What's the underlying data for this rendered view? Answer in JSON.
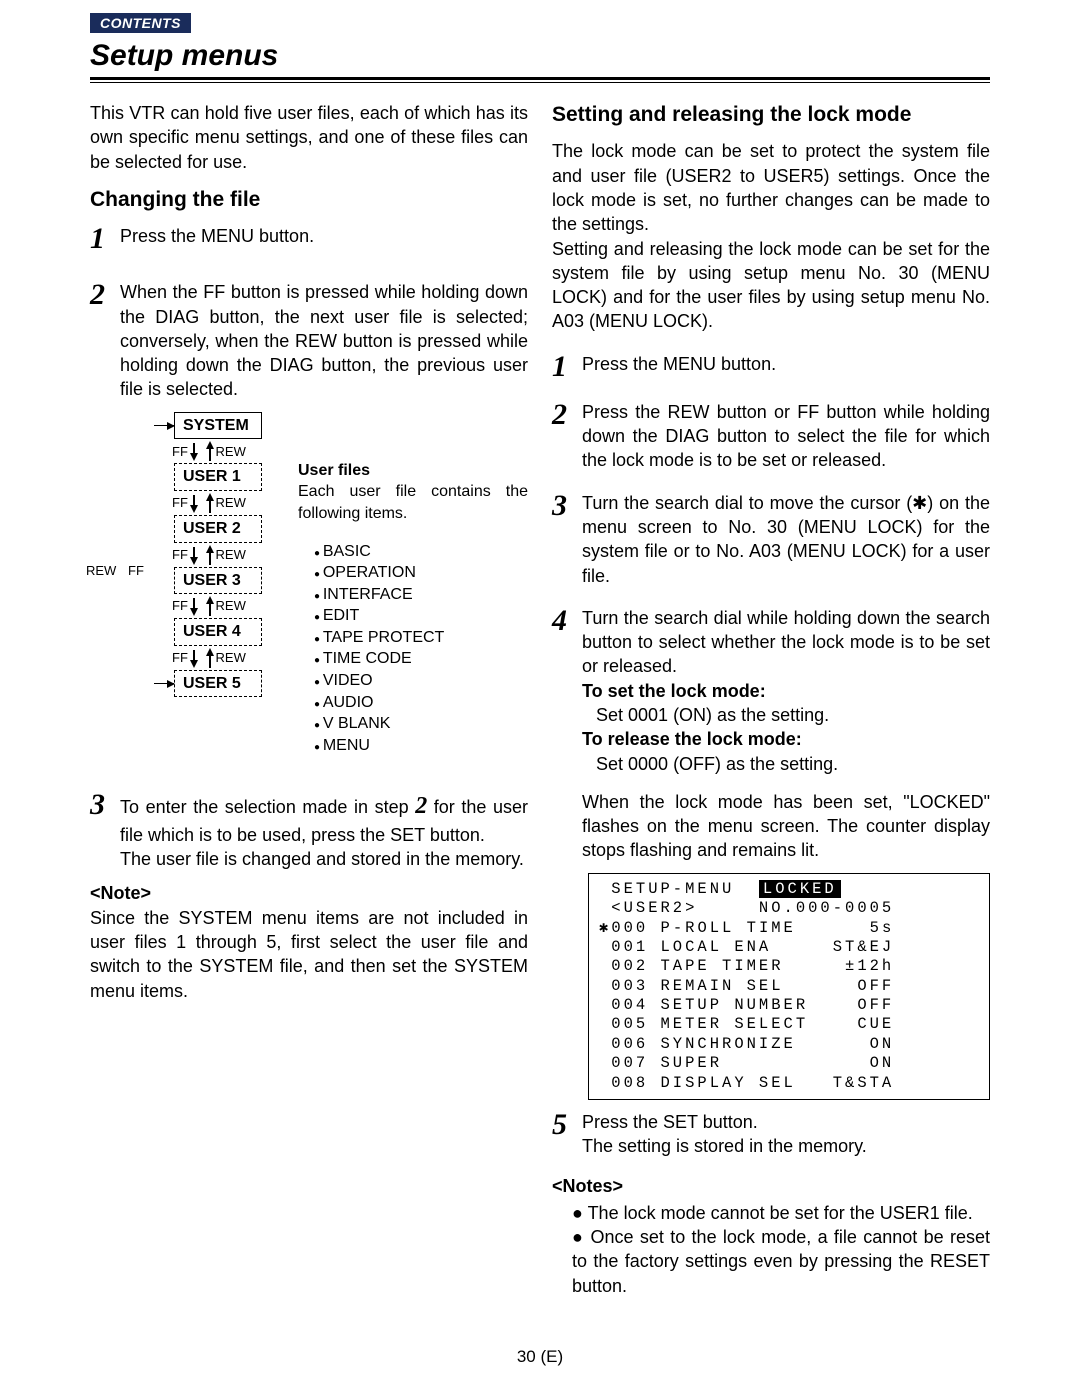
{
  "header": {
    "contents_label": "CONTENTS",
    "title": "Setup menus"
  },
  "left": {
    "intro": "This VTR can hold five user files, each of which has its own specific menu settings, and one of these files can be selected for use.",
    "h_changing": "Changing the file",
    "step1": "Press the MENU button.",
    "step2": "When the FF button is pressed while holding down the DIAG button, the next user file is selected; conversely, when the REW button is pressed while holding down the DIAG button, the previous user file is selected.",
    "step3a": "To enter the selection made in step",
    "step3b": "for the user file which is to be used, press the SET button.",
    "step3c": "The user file is changed and stored in the memory.",
    "note_head": "<Note>",
    "note_body": "Since the SYSTEM menu items are not included in user files 1 through 5, first select the user file and switch to the SYSTEM file, and then set the SYSTEM menu items.",
    "diagram": {
      "outer_rew": "REW",
      "outer_ff": "FF",
      "system": "SYSTEM",
      "user1": "USER 1",
      "user2": "USER 2",
      "user3": "USER 3",
      "user4": "USER 4",
      "user5": "USER 5",
      "nav_ff": "FF",
      "nav_rew": "REW",
      "right_title": "User files",
      "right_intro": "Each user file contains the following items.",
      "items": [
        "BASIC",
        "OPERATION",
        "INTERFACE",
        "EDIT",
        "TAPE PROTECT",
        "TIME CODE",
        "VIDEO",
        "AUDIO",
        "V BLANK",
        "MENU"
      ]
    }
  },
  "right": {
    "h_lock": "Setting and releasing the lock mode",
    "intro1": "The lock mode can be set to protect the system file and user file (USER2 to USER5) settings. Once the lock mode is set, no further changes can be made to the settings.",
    "intro2": "Setting and releasing the lock mode can be set for the system file by using setup menu No. 30 (MENU LOCK) and for the user files by using setup menu No. A03 (MENU LOCK).",
    "step1": "Press the MENU button.",
    "step2": "Press the REW button or FF button while holding down the DIAG button to select the file for which the lock mode is to be set or released.",
    "step3": "Turn the search dial to move the cursor (✱) on the menu screen to No. 30 (MENU LOCK) for the system file or to No. A03 (MENU LOCK) for a user file.",
    "step4_main": "Turn the search dial while holding down the search button to select whether the lock mode is to be set or released.",
    "step4_set_head": "To set the lock mode:",
    "step4_set_body": "Set 0001 (ON) as the setting.",
    "step4_rel_head": "To release the lock mode:",
    "step4_rel_body": "Set 0000 (OFF) as the setting.",
    "step4_locked": "When the lock mode has been set, \"LOCKED\" flashes on the menu screen. The counter display stops flashing and remains lit.",
    "step5a": "Press the SET button.",
    "step5b": "The setting is stored in the memory.",
    "notes_head": "<Notes>",
    "notes": [
      "The lock mode cannot be set for the USER1 file.",
      "Once set to the lock mode, a file cannot be reset to the factory settings even by pressing the RESET button."
    ],
    "lcd": {
      "line1a": " SETUP-MENU  ",
      "locked": "LOCKED",
      "line2": " <USER2>     NO.000-0005",
      "line3": "✱000 P-ROLL TIME      5s",
      "line4": " 001 LOCAL ENA     ST&EJ",
      "line5": " 002 TAPE TIMER     ±12h",
      "line6": " 003 REMAIN SEL      OFF",
      "line7": " 004 SETUP NUMBER    OFF",
      "line8": " 005 METER SELECT    CUE",
      "line9": " 006 SYNCHRONIZE      ON",
      "line10": " 007 SUPER            ON",
      "line11": " 008 DISPLAY SEL   T&STA"
    }
  },
  "page_number": "30 (E)"
}
